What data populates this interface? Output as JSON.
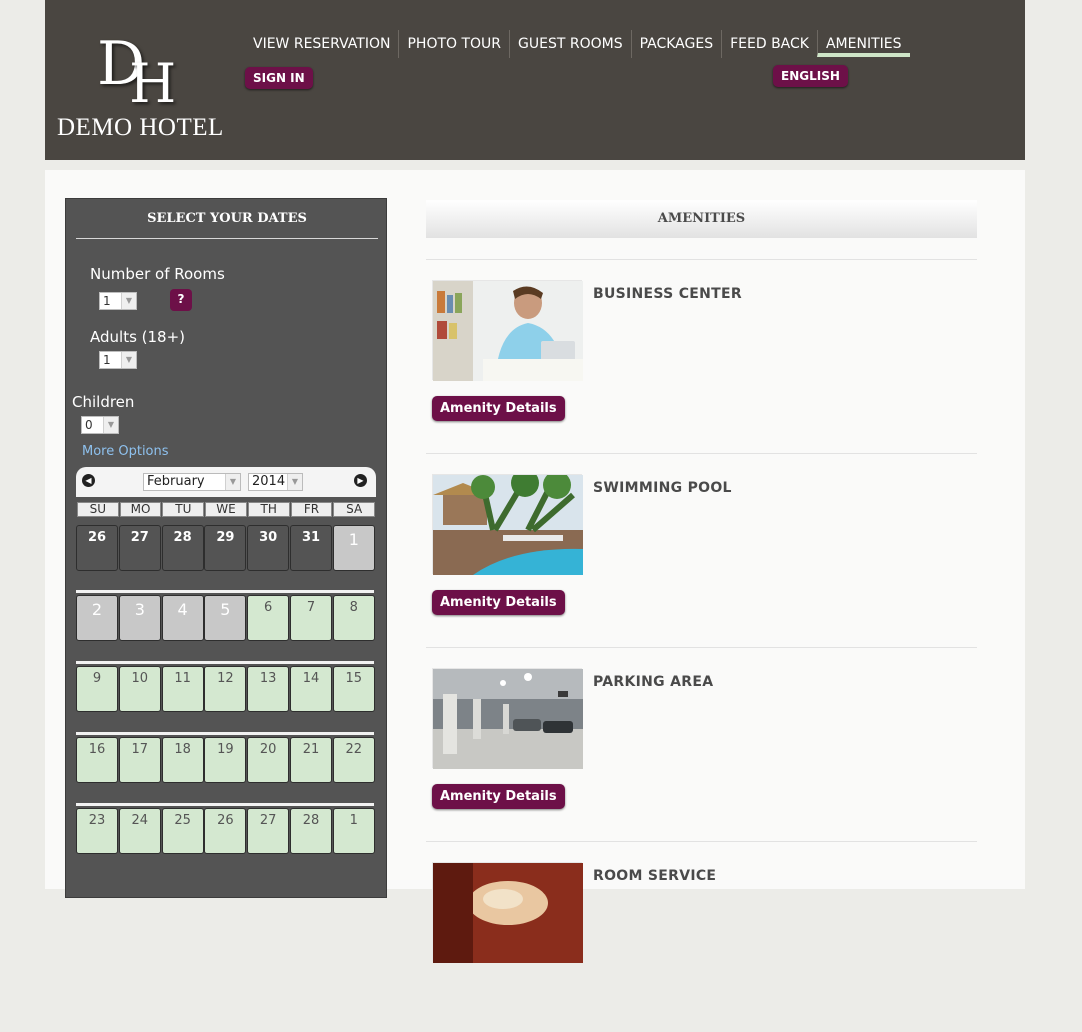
{
  "brand": {
    "name": "DEMO HOTEL",
    "monogram_d": "D",
    "monogram_h": "H"
  },
  "nav": {
    "items": [
      "VIEW RESERVATION",
      "PHOTO TOUR",
      "GUEST ROOMS",
      "PACKAGES",
      "FEED BACK",
      "AMENITIES"
    ],
    "active": "AMENITIES"
  },
  "header": {
    "sign_in": "SIGN IN",
    "language": "ENGLISH"
  },
  "booking": {
    "title": "SELECT YOUR DATES",
    "rooms": {
      "label": "Number of Rooms",
      "value": "1",
      "help": "?"
    },
    "adults": {
      "label": "Adults (18+)",
      "value": "1"
    },
    "children": {
      "label": "Children",
      "value": "0"
    },
    "more_options": "More Options",
    "calendar": {
      "month": "February",
      "year": "2014",
      "weekdays": [
        "SU",
        "MO",
        "TU",
        "WE",
        "TH",
        "FR",
        "SA"
      ],
      "weeks": [
        [
          "26",
          "27",
          "28",
          "29",
          "30",
          "31",
          "1"
        ],
        [
          "2",
          "3",
          "4",
          "5",
          "6",
          "7",
          "8"
        ],
        [
          "9",
          "10",
          "11",
          "12",
          "13",
          "14",
          "15"
        ],
        [
          "16",
          "17",
          "18",
          "19",
          "20",
          "21",
          "22"
        ],
        [
          "23",
          "24",
          "25",
          "26",
          "27",
          "28",
          "1"
        ]
      ],
      "states": [
        [
          "past",
          "past",
          "past",
          "past",
          "past",
          "past",
          "sel"
        ],
        [
          "sel",
          "sel",
          "sel",
          "sel",
          "avail",
          "avail",
          "avail"
        ],
        [
          "avail",
          "avail",
          "avail",
          "avail",
          "avail",
          "avail",
          "avail"
        ],
        [
          "avail",
          "avail",
          "avail",
          "avail",
          "avail",
          "avail",
          "avail"
        ],
        [
          "avail",
          "avail",
          "avail",
          "avail",
          "avail",
          "avail",
          "avail"
        ]
      ]
    }
  },
  "amenities": {
    "title": "AMENITIES",
    "details_label": "Amenity Details",
    "items": [
      {
        "name": "BUSINESS CENTER",
        "icon": "business-center-photo"
      },
      {
        "name": "SWIMMING POOL",
        "icon": "swimming-pool-photo"
      },
      {
        "name": "PARKING AREA",
        "icon": "parking-area-photo"
      },
      {
        "name": "ROOM SERVICE",
        "icon": "room-service-photo"
      }
    ]
  },
  "colors": {
    "header_bg": "#4a4641",
    "accent_plum": "#6d1048",
    "available_day": "#d4e8d0",
    "panel_bg": "#545454",
    "link_blue": "#8ec1ee"
  }
}
